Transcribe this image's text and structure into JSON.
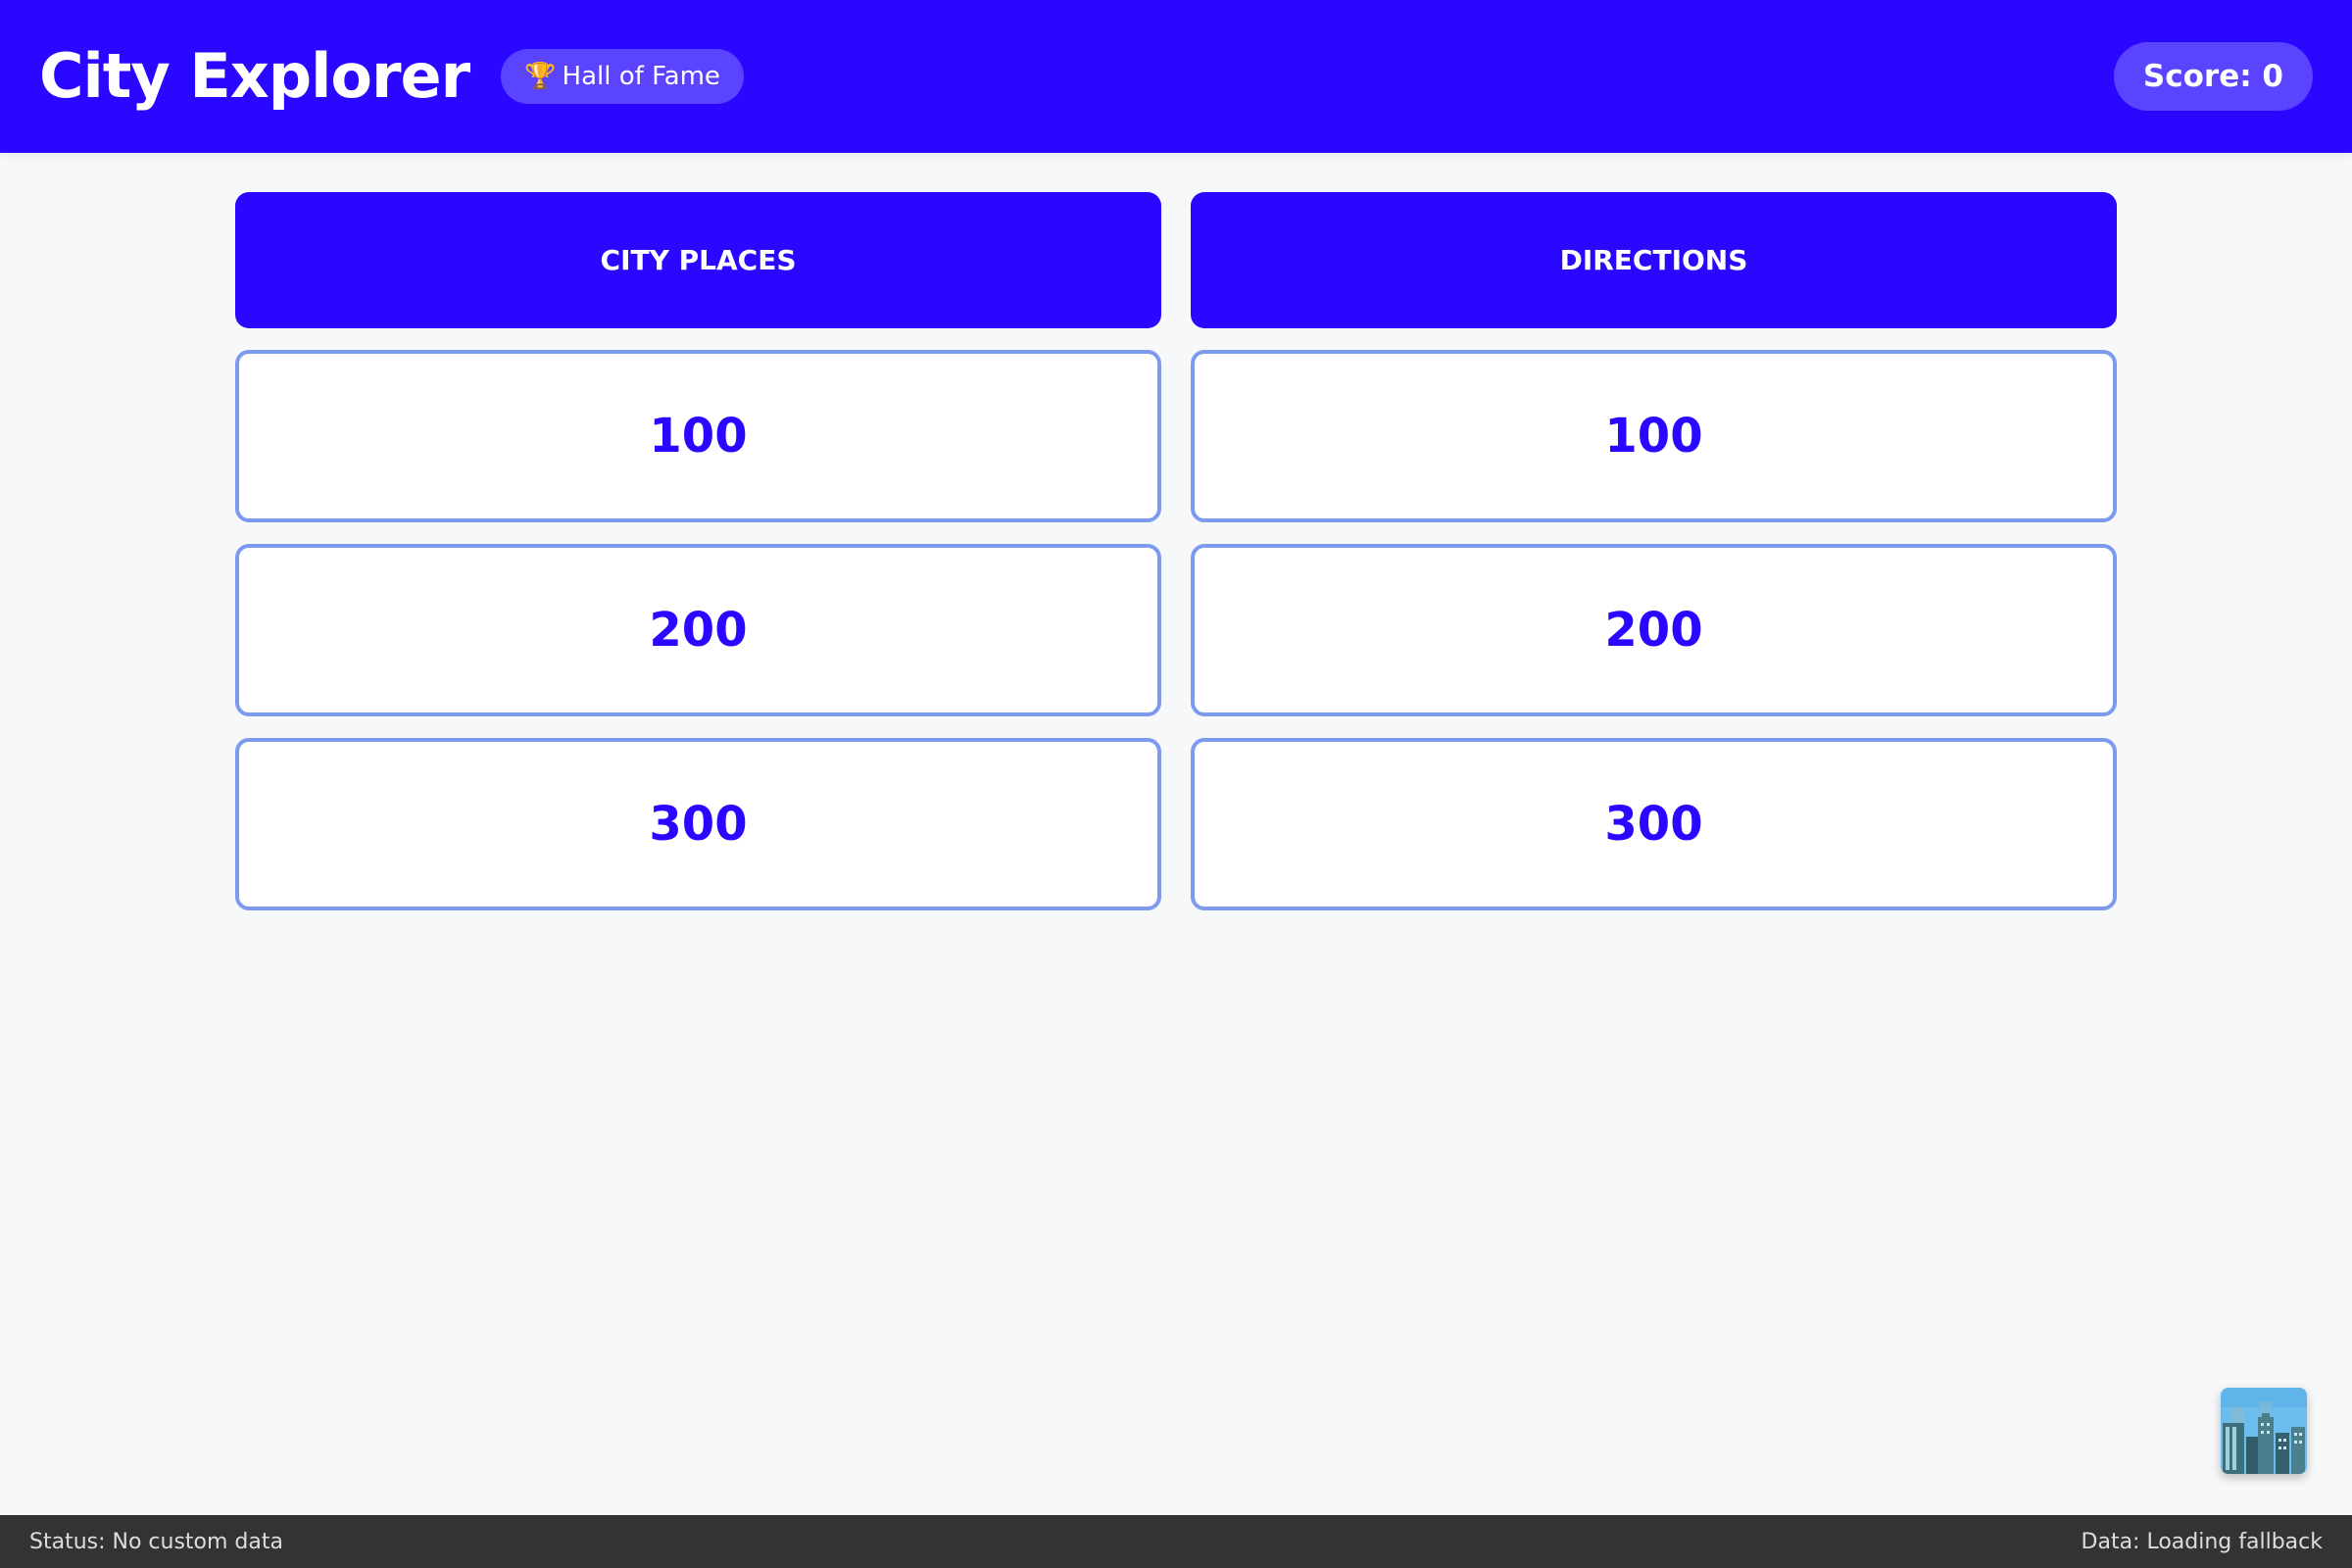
{
  "header": {
    "title": "City Explorer",
    "hall_of_fame_label": "Hall of Fame",
    "hall_of_fame_icon": "trophy-icon",
    "score_label": "Score: 0"
  },
  "board": {
    "categories": [
      {
        "name": "City Places",
        "values": [
          "100",
          "200",
          "300"
        ]
      },
      {
        "name": "Directions",
        "values": [
          "100",
          "200",
          "300"
        ]
      }
    ]
  },
  "floating_tile": {
    "icon": "city-skyline-icon"
  },
  "status_bar": {
    "left": "Status: No custom data",
    "right": "Data: Loading fallback"
  },
  "colors": {
    "primary": "#2a08ff",
    "pill": "#5a44ff",
    "card_border": "#7b9af0",
    "background": "#f7f8fa",
    "status_bar": "#333333"
  }
}
